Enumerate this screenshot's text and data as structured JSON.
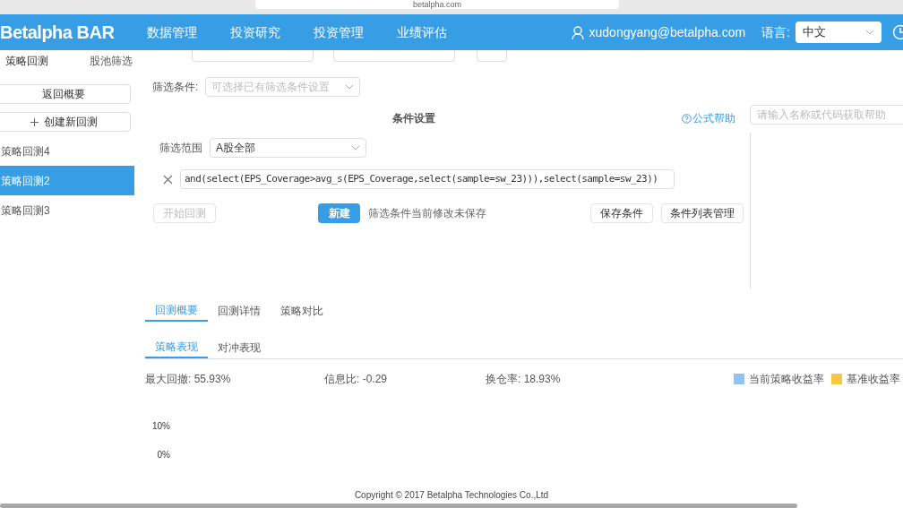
{
  "browser": {
    "url": "betalpha.com"
  },
  "nav": {
    "logo": "Betalpha BAR",
    "items": [
      {
        "label": "数据管理"
      },
      {
        "label": "投资研究"
      },
      {
        "label": "投资管理"
      },
      {
        "label": "业绩评估"
      }
    ],
    "user": "xudongyang@betalpha.com",
    "language_label": "语言:",
    "language": "中文"
  },
  "sidebar": {
    "tabs": [
      {
        "label": "策略回测",
        "selected": true
      },
      {
        "label": "股池筛选",
        "selected": false
      }
    ],
    "back_button": "返回概要",
    "create_button": "创建新回测",
    "items": [
      {
        "label": "策略回测4",
        "selected": false
      },
      {
        "label": "策略回测2",
        "selected": true
      },
      {
        "label": "策略回测3",
        "selected": false
      }
    ]
  },
  "form": {
    "filter_label": "筛选条件:",
    "filter_placeholder": "可选择已有筛选条件设置"
  },
  "conditions": {
    "title": "条件设置",
    "help_link": "公式帮助",
    "scope_label": "筛选范围",
    "scope": "A股全部",
    "formula": "and(select(EPS_Coverage>avg_s(EPS_Coverage,select(sample=sw_23))),select(sample=sw_23))",
    "start_button": {
      "label": "开始回测",
      "disabled": true
    },
    "new_button": "新建",
    "unsaved_note": "筛选条件当前修改未保存",
    "save_button": "保存条件",
    "manage_button": "条件列表管理"
  },
  "help_search": {
    "placeholder": "请输入名称或代码获取帮助"
  },
  "result_tabs": [
    {
      "label": "回测概要",
      "selected": true
    },
    {
      "label": "回测详情",
      "selected": false
    },
    {
      "label": "策略对比",
      "selected": false
    }
  ],
  "perf_tabs": [
    {
      "label": "策略表现",
      "selected": true
    },
    {
      "label": "对冲表现",
      "selected": false
    }
  ],
  "stats": [
    "最大回撤: 55.93%",
    "信息比: -0.29",
    "换仓率: 18.93%"
  ],
  "legend": [
    {
      "label": "当前策略收益率",
      "color": "#8ec4ee"
    },
    {
      "label": "基准收益率",
      "color": "#f7c844"
    }
  ],
  "chart": {
    "kind": "picture",
    "y_labels": [
      "10%",
      "0%"
    ]
  },
  "footer": "Copyright © 2017 Betalpha Technologies Co.,Ltd"
}
